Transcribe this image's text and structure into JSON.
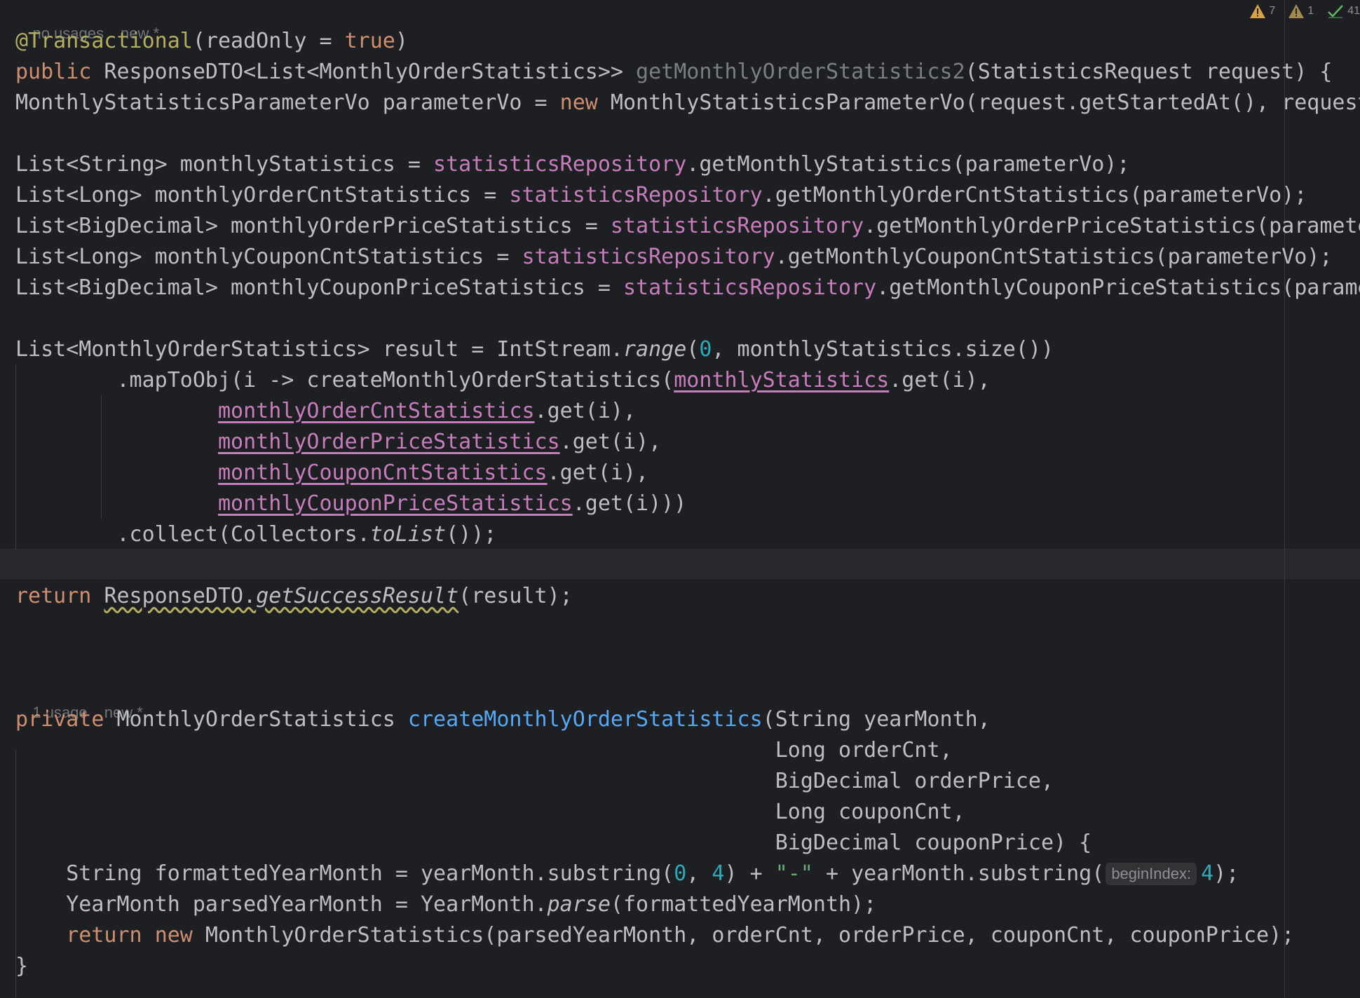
{
  "inspections": {
    "warnings_count": "7",
    "weak_warnings_count": "1",
    "ok_count": "41",
    "colors": {
      "warning": "#d9a343",
      "weak_warning": "#a38b4c",
      "ok": "#5fb865"
    }
  },
  "hints": {
    "method1_usage": "no usages",
    "method1_vcs": "new *",
    "method2_usage": "1 usage",
    "method2_vcs": "new *",
    "begin_index_label": "beginIndex:"
  },
  "colors": {
    "background": "#1e1f22",
    "keyword": "#cf8e6d",
    "annotation": "#b3ae60",
    "field": "#c77dbb",
    "number": "#2aacb8",
    "string": "#6aab73",
    "declaration": "#56a8f5",
    "text": "#bcbec4"
  },
  "code": {
    "line1": {
      "annotation": "@Transactional",
      "rest_a": "(readOnly = ",
      "kw": "true",
      "rest_b": ")"
    },
    "line2": {
      "kw": "public",
      "type": " ResponseDTO<List<MonthlyOrderStatistics>> ",
      "name": "getMonthlyOrderStatistics2",
      "rest": "(StatisticsRequest request) {"
    },
    "line3": {
      "a": "MonthlyStatisticsParameterVo parameterVo = ",
      "kw": "new",
      "b": " MonthlyStatisticsParameterVo(request.getStartedAt(), request.getEndedAt());"
    },
    "line4": {
      "a": "List<String> monthlyStatistics = ",
      "field": "statisticsRepository",
      "b": ".getMonthlyStatistics(parameterVo);"
    },
    "line5": {
      "a": "List<Long> monthlyOrderCntStatistics = ",
      "field": "statisticsRepository",
      "b": ".getMonthlyOrderCntStatistics(parameterVo);"
    },
    "line6": {
      "a": "List<BigDecimal> monthlyOrderPriceStatistics = ",
      "field": "statisticsRepository",
      "b": ".getMonthlyOrderPriceStatistics(parameterVo);"
    },
    "line7": {
      "a": "List<Long> monthlyCouponCntStatistics = ",
      "field": "statisticsRepository",
      "b": ".getMonthlyCouponCntStatistics(parameterVo);"
    },
    "line8": {
      "a": "List<BigDecimal> monthlyCouponPriceStatistics = ",
      "field": "statisticsRepository",
      "b": ".getMonthlyCouponPriceStatistics(parameterVo);"
    },
    "line9": {
      "a": "List<MonthlyOrderStatistics> result = IntStream.",
      "method": "range",
      "b": "(",
      "num": "0",
      "c": ", monthlyStatistics.size())"
    },
    "line10": {
      "a": "        .mapToObj(i -> createMonthlyOrderStatistics(",
      "var": "monthlyStatistics",
      "b": ".get(i),"
    },
    "line11": {
      "indent": "                ",
      "var": "monthlyOrderCntStatistics",
      "b": ".get(i),"
    },
    "line12": {
      "indent": "                ",
      "var": "monthlyOrderPriceStatistics",
      "b": ".get(i),"
    },
    "line13": {
      "indent": "                ",
      "var": "monthlyCouponCntStatistics",
      "b": ".get(i),"
    },
    "line14": {
      "indent": "                ",
      "var": "monthlyCouponPriceStatistics",
      "b": ".get(i)))"
    },
    "line15": {
      "a": "        .collect(Collectors.",
      "method": "toList",
      "b": "());"
    },
    "line16": {
      "kw": "return",
      "sp": " ",
      "call": "ResponseDTO.",
      "method": "getSuccessResult",
      "b": "(result);"
    },
    "line17": {
      "kw": "private",
      "type": " MonthlyOrderStatistics ",
      "name": "createMonthlyOrderStatistics",
      "rest": "(String yearMonth,"
    },
    "line18": {
      "indent": "                                                            ",
      "text": "Long orderCnt,"
    },
    "line19": {
      "indent": "                                                            ",
      "text": "BigDecimal orderPrice,"
    },
    "line20": {
      "indent": "                                                            ",
      "text": "Long couponCnt,"
    },
    "line21": {
      "indent": "                                                            ",
      "text": "BigDecimal couponPrice) {"
    },
    "line22": {
      "a": "    String formattedYearMonth = yearMonth.substring(",
      "n1": "0",
      "b": ", ",
      "n2": "4",
      "c": ") + ",
      "str": "\"-\"",
      "d": " + yearMonth.substring(",
      "n3": "4",
      "e": ");"
    },
    "line23": {
      "a": "    YearMonth parsedYearMonth = YearMonth.",
      "method": "parse",
      "b": "(formattedYearMonth);"
    },
    "line24": {
      "indent": "    ",
      "kw1": "return",
      "sp": " ",
      "kw2": "new",
      "b": " MonthlyOrderStatistics(parsedYearMonth, orderCnt, orderPrice, couponCnt, couponPrice);"
    },
    "line25": {
      "text": "}"
    }
  }
}
